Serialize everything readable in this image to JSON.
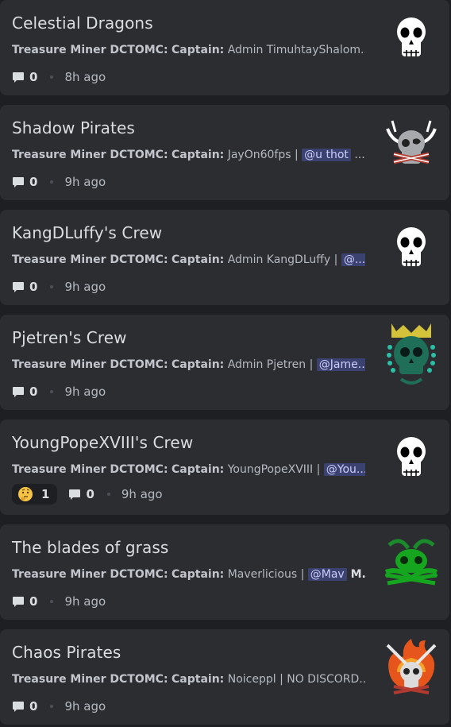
{
  "threads": [
    {
      "title": "Celestial Dragons",
      "author": "Treasure Miner DCTOMC:",
      "label": "Captain:",
      "text": " Admin TimuhtayShalom...",
      "mention": "",
      "trailing": "",
      "message_count": "0",
      "time": "8h ago",
      "reaction": null,
      "icon": "skull-icon"
    },
    {
      "title": "Shadow Pirates",
      "author": "Treasure Miner DCTOMC:",
      "label": "Captain:",
      "text": " JayOn60fps | ",
      "mention": "@u thot",
      "trailing": " ...",
      "message_count": "0",
      "time": "9h ago",
      "reaction": null,
      "icon": "horned-skull-icon"
    },
    {
      "title": "KangDLuffy's Crew",
      "author": "Treasure Miner DCTOMC:",
      "label": "Captain:",
      "text": " Admin KangDLuffy | ",
      "mention": "@...",
      "trailing": "",
      "message_count": "0",
      "time": "9h ago",
      "reaction": null,
      "icon": "skull-icon"
    },
    {
      "title": "Pjetren's Crew",
      "author": "Treasure Miner DCTOMC:",
      "label": "Captain:",
      "text": " Admin Pjetren | ",
      "mention": "@Jame...",
      "trailing": "",
      "message_count": "0",
      "time": "9h ago",
      "reaction": null,
      "icon": "crowned-skull-icon"
    },
    {
      "title": "YoungPopeXVIII's Crew",
      "author": "Treasure Miner DCTOMC:",
      "label": "Captain:",
      "text": " YoungPopeXVIII | ",
      "mention": "@You...",
      "trailing": "",
      "message_count": "0",
      "time": "9h ago",
      "reaction": {
        "emoji": "thinking-face-icon",
        "count": "1"
      },
      "icon": "skull-icon"
    },
    {
      "title": "The blades of grass",
      "author": "Treasure Miner DCTOMC:",
      "label": "Captain:",
      "text": " Maverlicious | ",
      "mention": "@Mav",
      "trailing": " M...",
      "message_count": "0",
      "time": "9h ago",
      "reaction": null,
      "icon": "green-skull-icon"
    },
    {
      "title": "Chaos Pirates",
      "author": "Treasure Miner DCTOMC:",
      "label": "Captain:",
      "text": " Noiceppl | NO DISCORD...",
      "mention": "",
      "trailing": "",
      "message_count": "0",
      "time": "9h ago",
      "reaction": null,
      "icon": "flaming-skull-icon"
    }
  ],
  "colors": {
    "background": "#1e1f22",
    "card": "#2b2d31",
    "title": "#dbdee1",
    "muted": "#b5bac1",
    "mention_bg": "#3c4270"
  }
}
